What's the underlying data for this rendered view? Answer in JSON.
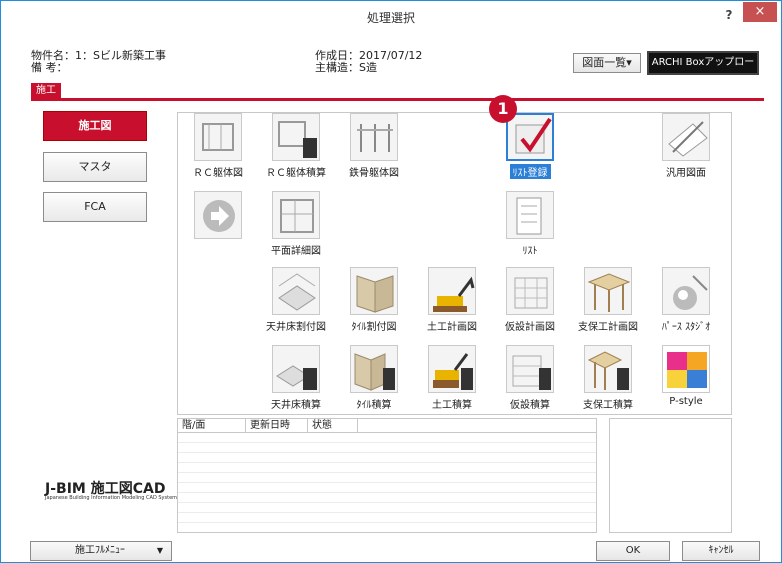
{
  "window": {
    "title": "処理選択",
    "help": "?",
    "close": "×"
  },
  "info": {
    "property_label": "物件名：1：Sビル新築工事",
    "note_label": "備 考：",
    "created_label": "作成日：2017/07/12",
    "structure_label": "主構造：S造"
  },
  "toolbar": {
    "drawing_list": "図面一覧▾",
    "archi_upload": "ARCHI Boxアップロード"
  },
  "tab": {
    "label": "施工"
  },
  "sidebar": {
    "items": [
      {
        "label": "施工図",
        "active": true
      },
      {
        "label": "マスタ",
        "active": false
      },
      {
        "label": "FCA",
        "active": false
      }
    ],
    "brand": "J-BIM 施工図CAD",
    "brand_sub": "Japanese Building Information Modeling CAD System"
  },
  "grid": {
    "items": [
      {
        "label": "ＲＣ躯体図",
        "icon": "rc-frame-drawing-icon"
      },
      {
        "label": "ＲＣ躯体積算",
        "icon": "rc-frame-estimate-icon"
      },
      {
        "label": "鉄骨躯体図",
        "icon": "steel-frame-drawing-icon"
      },
      {
        "label": "ﾘｽﾄ登録",
        "icon": "list-register-icon",
        "selected": true
      },
      {
        "label": "汎用図面",
        "icon": "general-drawing-icon"
      },
      {
        "label": "",
        "icon": "arrow-next-icon"
      },
      {
        "label": "平面詳細図",
        "icon": "floor-detail-icon"
      },
      {
        "label": "ﾘｽﾄ",
        "icon": "list-icon"
      },
      {
        "label": "天井床割付図",
        "icon": "ceiling-floor-layout-icon"
      },
      {
        "label": "ﾀｲﾙ割付図",
        "icon": "tile-layout-icon"
      },
      {
        "label": "土工計画図",
        "icon": "earthwork-plan-icon"
      },
      {
        "label": "仮設計画図",
        "icon": "temporary-plan-icon"
      },
      {
        "label": "支保工計画図",
        "icon": "shoring-plan-icon"
      },
      {
        "label": "ﾊﾟｰｽ ｽﾀｼﾞｵ",
        "icon": "perspective-studio-icon"
      },
      {
        "label": "天井床積算",
        "icon": "ceiling-floor-estimate-icon"
      },
      {
        "label": "ﾀｲﾙ積算",
        "icon": "tile-estimate-icon"
      },
      {
        "label": "土工積算",
        "icon": "earthwork-estimate-icon"
      },
      {
        "label": "仮設積算",
        "icon": "temporary-estimate-icon"
      },
      {
        "label": "支保工積算",
        "icon": "shoring-estimate-icon"
      },
      {
        "label": "P-style",
        "icon": "pstyle-icon"
      }
    ]
  },
  "callout": {
    "number": "1"
  },
  "table": {
    "columns": [
      "階/面",
      "更新日時",
      "状態"
    ]
  },
  "bottom": {
    "menu": "施工ﾌﾙﾒﾆｭｰ",
    "ok": "OK",
    "cancel": "ｷｬﾝｾﾙ"
  },
  "colors": {
    "accent": "#c8102e",
    "selection": "#2b7fd6",
    "window_border": "#1f8fd6"
  }
}
